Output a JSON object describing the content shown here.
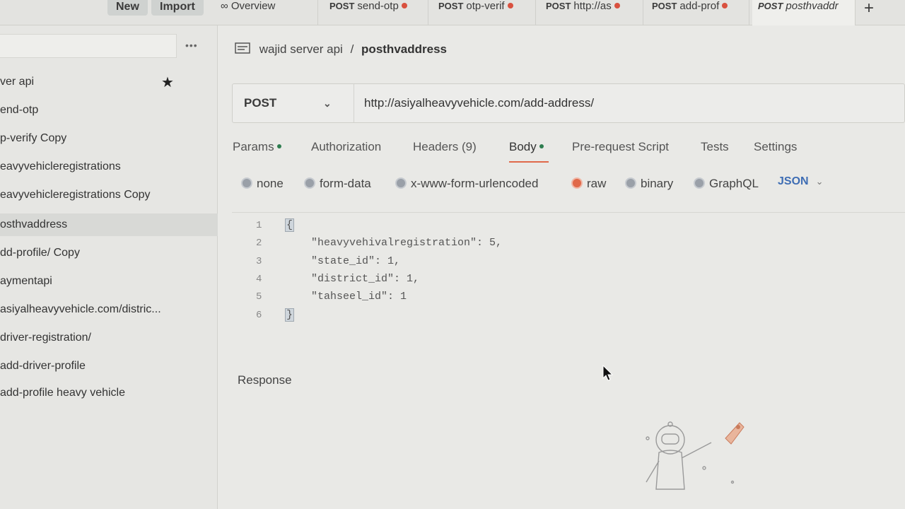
{
  "topbar": {
    "new_label": "New",
    "import_label": "Import",
    "tabs": [
      {
        "method": "",
        "title": "Overview",
        "dirty": false
      },
      {
        "method": "POST",
        "title": "send-otp",
        "dirty": true
      },
      {
        "method": "POST",
        "title": "otp-verif",
        "dirty": true
      },
      {
        "method": "POST",
        "title": "http://as",
        "dirty": true
      },
      {
        "method": "POST",
        "title": "add-prof",
        "dirty": true
      },
      {
        "method": "POST",
        "title": "posthvaddr",
        "dirty": false
      }
    ],
    "new_tab_label": "+"
  },
  "sidebar": {
    "more_label": "•••",
    "items": [
      "ver api",
      "end-otp",
      "p-verify Copy",
      "eavyvehicleregistrations",
      "eavyvehicleregistrations Copy",
      "osthvaddress",
      "dd-profile/ Copy",
      "aymentapi",
      "asiyalheavyvehicle.com/distric...",
      "driver-registration/",
      "add-driver-profile",
      "add-profile heavy vehicle"
    ],
    "active_index": 5
  },
  "breadcrumb": {
    "collection": "wajid server api",
    "separator": "/",
    "request": "posthvaddress"
  },
  "request": {
    "method": "POST",
    "url": "http://asiyalheavyvehicle.com/add-address/"
  },
  "request_tabs": {
    "params": "Params",
    "authorization": "Authorization",
    "headers": "Headers (9)",
    "body": "Body",
    "prerequest": "Pre-request Script",
    "tests": "Tests",
    "settings": "Settings"
  },
  "body_types": {
    "none": "none",
    "form_data": "form-data",
    "urlencoded": "x-www-form-urlencoded",
    "raw": "raw",
    "binary": "binary",
    "graphql": "GraphQL",
    "format": "JSON"
  },
  "editor": {
    "line_numbers": [
      "1",
      "2",
      "3",
      "4",
      "5",
      "6"
    ],
    "lines": [
      "{",
      "    \"heavyvehivalregistration\": 5,",
      "    \"state_id\": 1,",
      "    \"district_id\": 1,",
      "    \"tahseel_id\": 1",
      "}"
    ]
  },
  "response_label": "Response",
  "colors": {
    "accent": "#e0694a",
    "dirty_dot": "#d9513f",
    "status_dot": "#2e7d4f",
    "json_blue": "#3e6db4"
  }
}
